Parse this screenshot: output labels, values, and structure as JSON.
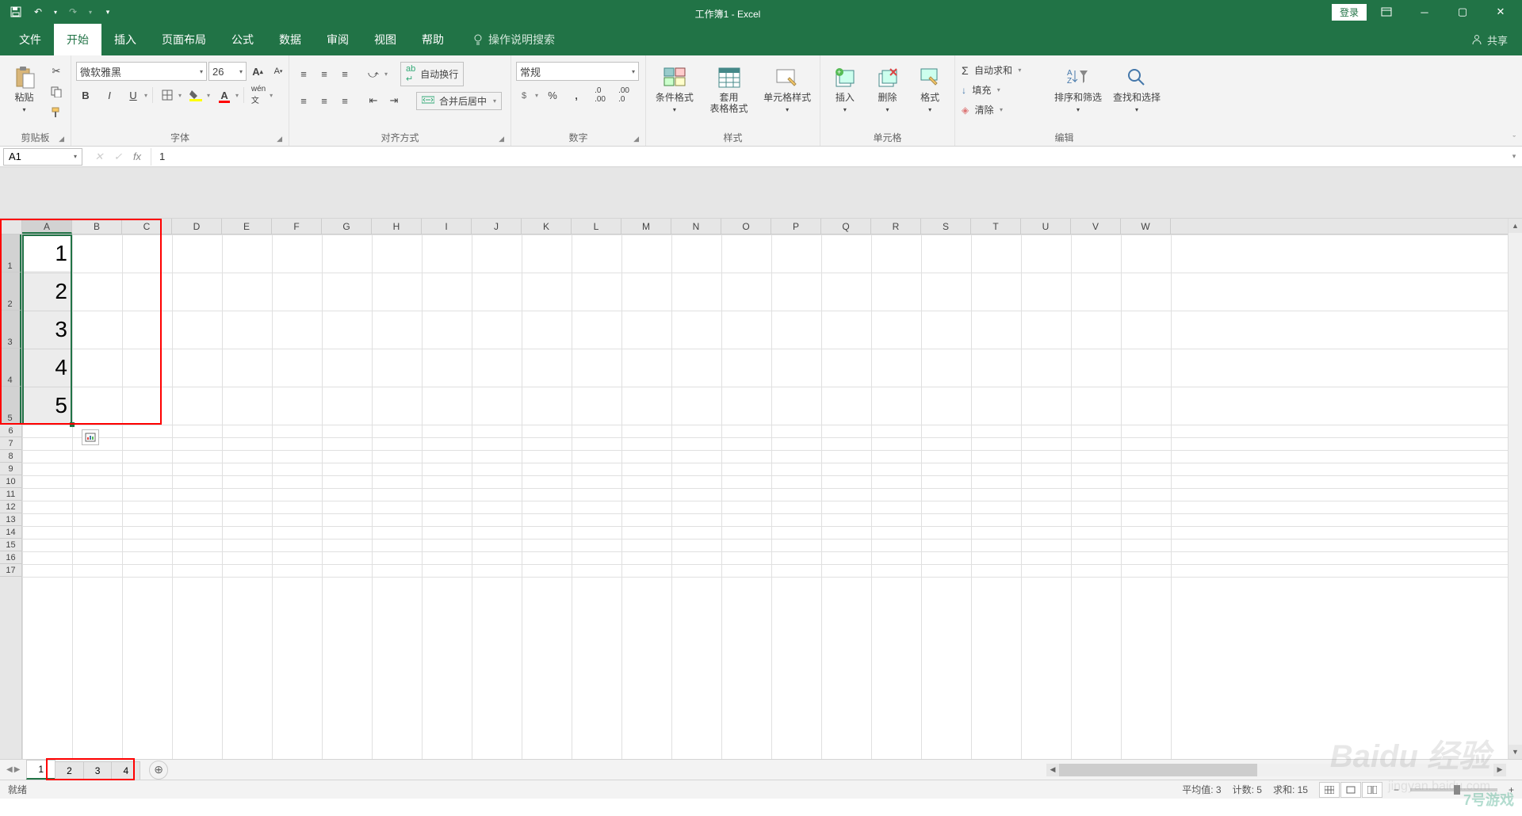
{
  "title": "工作簿1 - Excel",
  "login": "登录",
  "tabs": {
    "file": "文件",
    "home": "开始",
    "insert": "插入",
    "pagelayout": "页面布局",
    "formulas": "公式",
    "data": "数据",
    "review": "审阅",
    "view": "视图",
    "help": "帮助",
    "tellme": "操作说明搜索",
    "share": "共享"
  },
  "ribbon": {
    "clipboard": {
      "paste": "粘贴",
      "label": "剪贴板"
    },
    "font": {
      "name": "微软雅黑",
      "size": "26",
      "label": "字体"
    },
    "align": {
      "wrap": "自动换行",
      "merge": "合并后居中",
      "label": "对齐方式"
    },
    "number": {
      "format": "常规",
      "label": "数字"
    },
    "styles": {
      "cond": "条件格式",
      "table": "套用\n表格格式",
      "cell": "单元格样式",
      "label": "样式"
    },
    "cells": {
      "insert": "插入",
      "delete": "删除",
      "format": "格式",
      "label": "单元格"
    },
    "editing": {
      "sum": "自动求和",
      "fill": "填充",
      "clear": "清除",
      "sort": "排序和筛选",
      "find": "查找和选择",
      "label": "编辑"
    }
  },
  "namebox": "A1",
  "formula": "1",
  "columns": [
    "A",
    "B",
    "C",
    "D",
    "E",
    "F",
    "G",
    "H",
    "I",
    "J",
    "K",
    "L",
    "M",
    "N",
    "O",
    "P",
    "Q",
    "R",
    "S",
    "T",
    "U",
    "V",
    "W"
  ],
  "rows_tall": [
    1,
    2,
    3,
    4,
    5
  ],
  "rows_small": [
    6,
    7,
    8,
    9,
    10,
    11,
    12,
    13,
    14,
    15,
    16,
    17
  ],
  "cell_values": {
    "A1": "1",
    "A2": "2",
    "A3": "3",
    "A4": "4",
    "A5": "5"
  },
  "sheets": [
    "1",
    "2",
    "3",
    "4"
  ],
  "active_sheet": 0,
  "status": {
    "ready": "就绪",
    "avg": "平均值: 3",
    "count": "计数: 5",
    "sum": "求和: 15"
  },
  "watermark": "Baidu 经验",
  "watermark2": "jingyan.baidu.com",
  "watermark3": "7号游戏"
}
